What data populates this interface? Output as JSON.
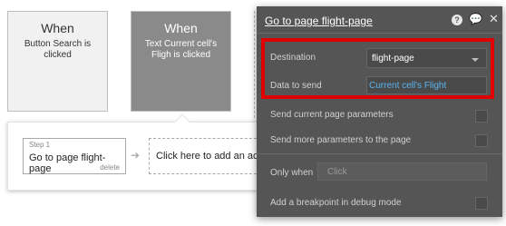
{
  "events": [
    {
      "title": "When",
      "desc": "Button Search is clicked"
    },
    {
      "title": "When",
      "desc": "Text Current cell's Fligh is clicked"
    }
  ],
  "workflow": {
    "step_label": "Step 1",
    "step_title": "Go to page flight-page",
    "step_delete": "delete",
    "add_action": "Click here to add an action..."
  },
  "panel": {
    "title": "Go to page flight-page",
    "help_glyph": "?",
    "comment_glyph": "💬",
    "close_glyph": "✕",
    "destination_label": "Destination",
    "destination_value": "flight-page",
    "data_to_send_label": "Data to send",
    "data_to_send_value": "Current cell's Flight",
    "send_current_params": "Send current page parameters",
    "send_more_params": "Send more parameters to the page",
    "only_when_label": "Only when",
    "only_when_placeholder": "Click",
    "breakpoint": "Add a breakpoint in debug mode"
  },
  "colors": {
    "highlight": "#e00000",
    "link": "#58b4f0",
    "panel_bg": "#555555"
  }
}
